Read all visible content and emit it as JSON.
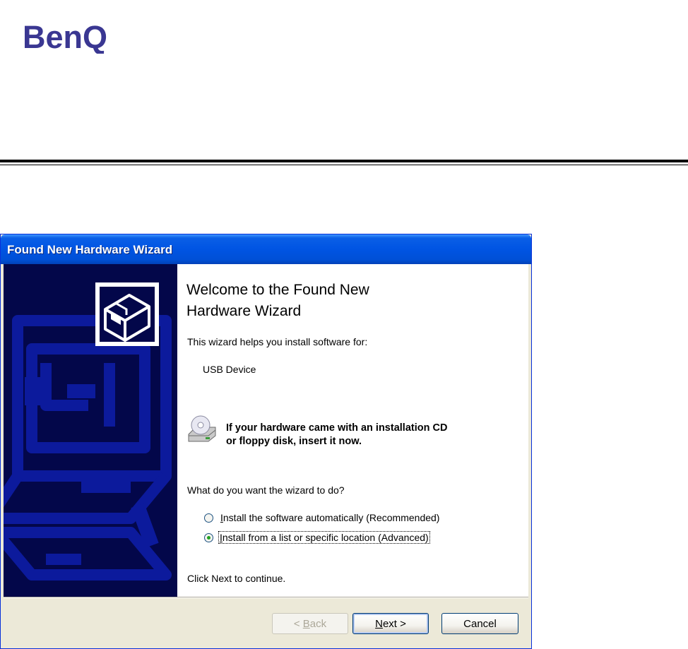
{
  "logo": {
    "text": "BenQ",
    "color": "#3a3792"
  },
  "window": {
    "title": "Found New Hardware Wizard",
    "heading_line1": "Welcome to the Found New",
    "heading_line2": "Hardware Wizard",
    "intro": "This wizard helps you install software for:",
    "device_name": "USB Device",
    "cd_notice_line1": "If your hardware came with an installation CD",
    "cd_notice_line2": "or floppy disk, insert it now.",
    "question": "What do you want the wizard to do?",
    "options": [
      {
        "label_rest": "nstall the software automatically (Recommended)",
        "mnemonic": "I",
        "selected": false
      },
      {
        "label_rest": "nstall from a list or specific location (Advanced)",
        "mnemonic": "I",
        "selected": true
      }
    ],
    "footer_hint": "Click Next to continue.",
    "buttons": {
      "back_prefix": "< ",
      "back_mnemonic": "B",
      "back_rest": "ack",
      "next_mnemonic": "N",
      "next_rest": "ext >",
      "cancel": "Cancel"
    },
    "icons": [
      "hardware-icon",
      "cd-drive-icon"
    ],
    "colors": {
      "titlebar": "#0054e3",
      "left_panel": "#03074a",
      "panel_shapes": "#0c1a9c",
      "radio_dot": "#21a121"
    }
  }
}
